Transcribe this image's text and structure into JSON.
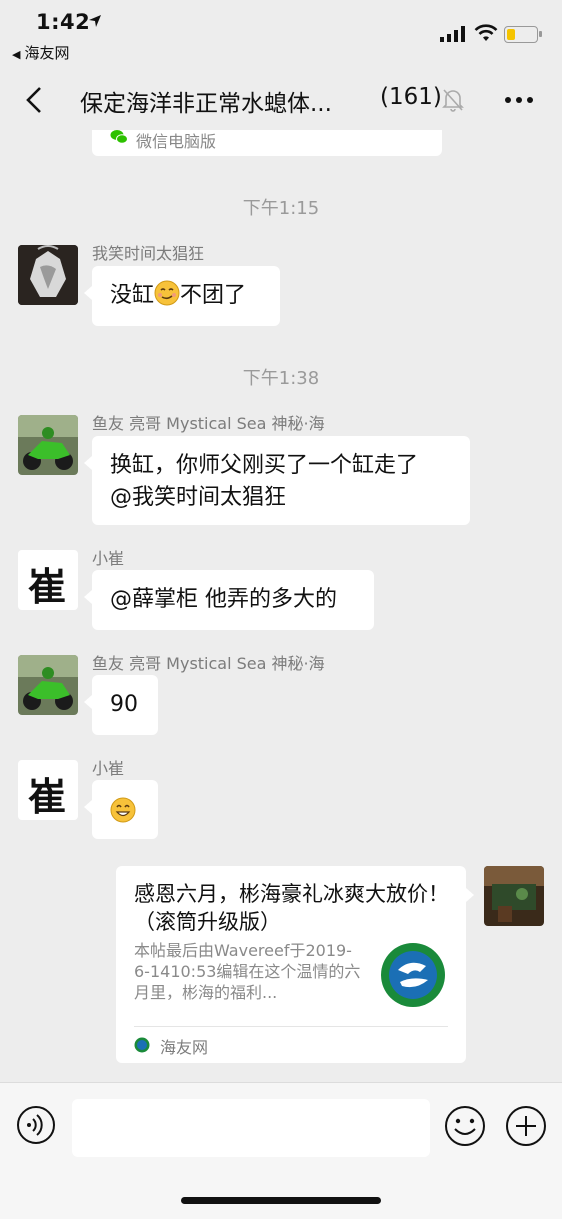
{
  "status_bar": {
    "time": "1:42",
    "back_app": "海友网"
  },
  "nav": {
    "title": "保定海洋非正常水螅体...",
    "member_count": "(161)"
  },
  "top_card": {
    "label": "微信电脑版"
  },
  "messages": [
    {
      "type": "timestamp",
      "text": "下午1:15"
    },
    {
      "type": "text",
      "sender": "我笑时间太猖狂",
      "parts": [
        "没缸",
        "不团了"
      ],
      "emoji": "smirk-emoji"
    },
    {
      "type": "timestamp",
      "text": "下午1:38"
    },
    {
      "type": "text",
      "sender": "鱼友 亮哥 Mystical Sea 神秘·海",
      "lines": [
        "换缸，你师父刚买了一个缸走了",
        "@我笑时间太猖狂"
      ]
    },
    {
      "type": "text",
      "sender": "小崔",
      "text": "@薛掌柜 他弄的多大的"
    },
    {
      "type": "text",
      "sender": "鱼友 亮哥 Mystical Sea 神秘·海",
      "text": "90"
    },
    {
      "type": "emoji",
      "sender": "小崔",
      "emoji": "grin-emoji"
    }
  ],
  "link_card": {
    "title": "感恩六月，彬海豪礼冰爽大放价！（滚筒升级版）",
    "description": "本帖最后由Wavereef于2019-6-1410:53编辑在这个温情的六月里，彬海的福利...",
    "source": "海友网"
  },
  "avatars": {
    "xiaocui": "崔"
  },
  "colors": {
    "bg": "#ededed",
    "bubble": "#ffffff",
    "timestamp": "#9a9a9a",
    "name": "#7c7c7c"
  }
}
